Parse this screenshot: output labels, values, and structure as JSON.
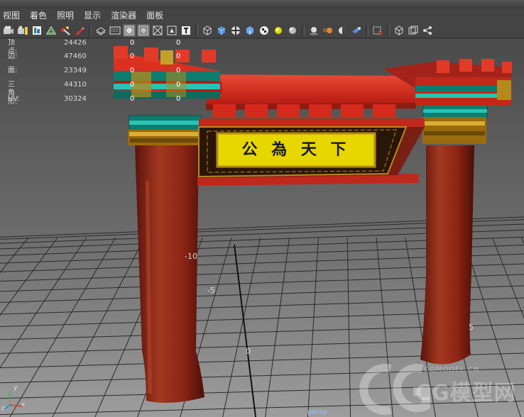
{
  "menu": [
    "视图",
    "着色",
    "照明",
    "显示",
    "渲染器",
    "面板"
  ],
  "toolbar_icons": [
    "camera-attribute-icon",
    "camera-bookmark-icon",
    "image-plane-icon",
    "grid-icon",
    "select-camera-icon",
    "wireframe-icon",
    "smooth-shade-icon",
    "shaded-box-icon",
    "default-light-icon",
    "xray-icon",
    "texture-icon",
    "isolate-select-icon",
    "shaded-cube-icon",
    "checker-ball-icon",
    "texture-checker-icon",
    "light-bulb-icon",
    "sphere-icon",
    "ambient-occlusion-icon",
    "motion-blur-icon",
    "anti-alias-icon",
    "depth-of-field-icon",
    "snapshot-icon",
    "cube-outline-icon",
    "resolution-gate-icon",
    "hierarchy-icon"
  ],
  "hud": {
    "rows": [
      {
        "label": "顶点:",
        "value": "24426",
        "c1": "0",
        "c2": "0"
      },
      {
        "label": "边:",
        "value": "47460",
        "c1": "0",
        "c2": "0"
      },
      {
        "label": "面:",
        "value": "23349",
        "c1": "0",
        "c2": "0"
      },
      {
        "label": "三角形:",
        "value": "44310",
        "c1": "0",
        "c2": "0"
      },
      {
        "label": "UV:",
        "value": "30324",
        "c1": "0",
        "c2": "0"
      }
    ]
  },
  "plaque_text": "公 為 天 下",
  "grid_labels": {
    "a": "-10",
    "b": "-5",
    "c": "0",
    "d": "5"
  },
  "camera_label": "persp",
  "axis": {
    "x": "x",
    "y": "y",
    "z": "z"
  },
  "watermark": {
    "small": "CGMODEL.CN",
    "big": "CG模型网"
  },
  "colors": {
    "background_top": "#4a4a4a",
    "background_bottom": "#9a9a9a",
    "pillar_red": "#8a2414",
    "roof_red": "#d5291e",
    "teal_band": "#0f9d8f",
    "plaque_yellow": "#e7d600",
    "gold": "#b58a1c"
  }
}
